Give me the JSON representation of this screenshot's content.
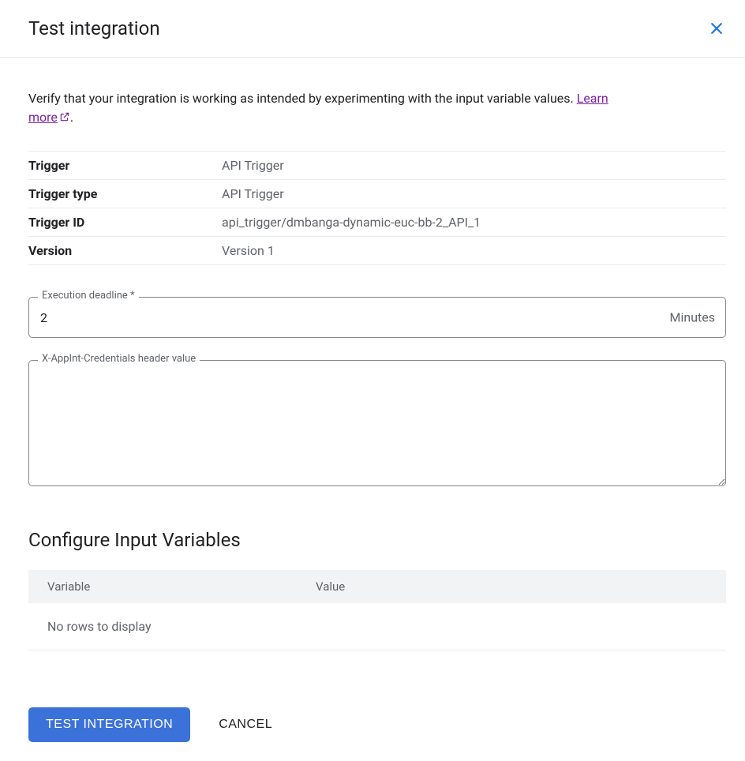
{
  "header": {
    "title": "Test integration"
  },
  "intro": {
    "text_before": "Verify that your integration is working as intended by experimenting with the input variable values. ",
    "learn_more": "Learn more",
    "text_after": "."
  },
  "info": {
    "trigger_label": "Trigger",
    "trigger_value": "API Trigger",
    "trigger_type_label": "Trigger type",
    "trigger_type_value": "API Trigger",
    "trigger_id_label": "Trigger ID",
    "trigger_id_value": "api_trigger/dmbanga-dynamic-euc-bb-2_API_1",
    "version_label": "Version",
    "version_value": "Version 1"
  },
  "fields": {
    "deadline_label": "Execution deadline *",
    "deadline_value": "2",
    "deadline_suffix": "Minutes",
    "credentials_label": "X-AppInt-Credentials header value",
    "credentials_value": ""
  },
  "variables": {
    "section_title": "Configure Input Variables",
    "column_variable": "Variable",
    "column_value": "Value",
    "empty_text": "No rows to display"
  },
  "actions": {
    "primary": "Test Integration",
    "cancel": "Cancel"
  }
}
